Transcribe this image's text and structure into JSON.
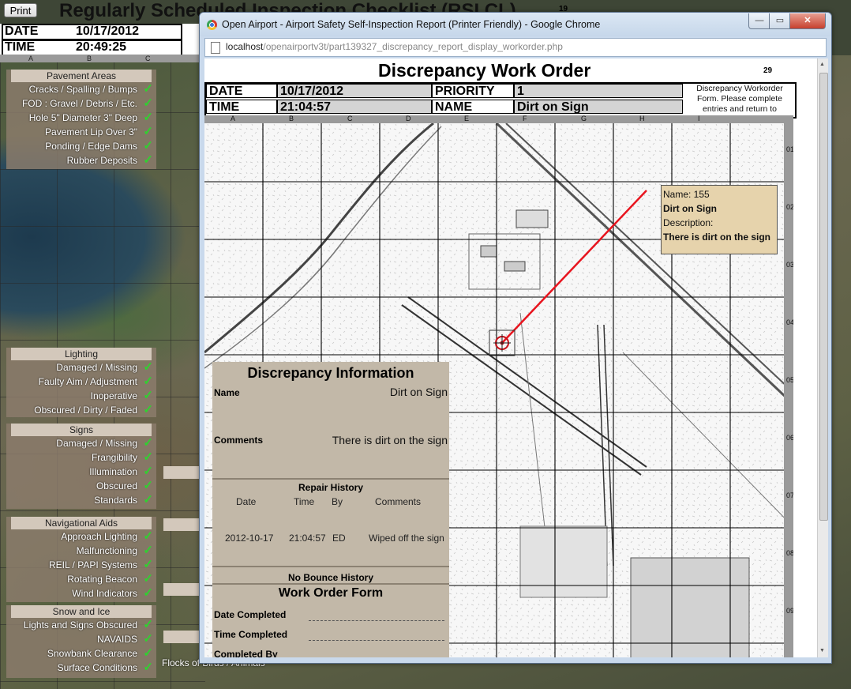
{
  "background": {
    "print_label": "Print",
    "title": "Regularly Scheduled Inspection Checklist (RSI CL)",
    "page_number": "19",
    "date_label": "DATE",
    "date_value": "10/17/2012",
    "time_label": "TIME",
    "time_value": "20:49:25",
    "columns": [
      "A",
      "B",
      "C"
    ],
    "check_glyph": "✓",
    "panels": [
      {
        "title": "Pavement Areas",
        "items": [
          "Cracks / Spalling / Bumps",
          "FOD : Gravel / Debris / Etc.",
          "Hole 5\" Diameter 3\" Deep",
          "Pavement Lip Over 3\"",
          "Ponding / Edge Dams",
          "Rubber Deposits"
        ]
      },
      {
        "title": "Lighting",
        "items": [
          "Damaged / Missing",
          "Faulty Aim / Adjustment",
          "Inoperative",
          "Obscured / Dirty / Faded"
        ]
      },
      {
        "title": "Signs",
        "items": [
          "Damaged / Missing",
          "Frangibility",
          "Illumination",
          "Obscured",
          "Standards"
        ]
      },
      {
        "title": "Navigational Aids",
        "items": [
          "Approach Lighting",
          "Malfunctioning",
          "REIL / PAPI Systems",
          "Rotating Beacon",
          "Wind Indicators"
        ]
      },
      {
        "title": "Snow and Ice",
        "items": [
          "Lights and Signs Obscured",
          "NAVAIDS",
          "Snowbank Clearance",
          "Surface Conditions"
        ]
      }
    ],
    "partial_item": "Flocks of Birds / Animals"
  },
  "browser": {
    "window_title": "Open Airport - Airport Safety Self-Inspection Report (Printer Friendly) - Google Chrome",
    "url_host": "localhost",
    "url_path": "/openairportv3t/part139327_discrepancy_report_display_workorder.php",
    "minimize_glyph": "—",
    "maximize_glyph": "▭",
    "close_glyph": "✕"
  },
  "workorder": {
    "title": "Discrepancy Work Order",
    "page_number": "29",
    "date_label": "DATE",
    "date_value": "10/17/2012",
    "time_label": "TIME",
    "time_value": "21:04:57",
    "priority_label": "PRIORITY",
    "priority_value": "1",
    "name_label": "NAME",
    "name_value": "Dirt on Sign",
    "note": "Discrepancy Workorder Form. Please complete entries and return to management.",
    "map_columns": [
      "A",
      "B",
      "C",
      "D",
      "E",
      "F",
      "G",
      "H",
      "I"
    ],
    "map_rows": [
      "01",
      "02",
      "03",
      "04",
      "05",
      "06",
      "07",
      "08",
      "09"
    ],
    "callout": {
      "name_line": "Name: 155",
      "title": "Dirt on Sign",
      "desc_label": "Description:",
      "desc_value": "There is dirt on the sign"
    },
    "info": {
      "title": "Discrepancy Information",
      "name_label": "Name",
      "name_value": "Dirt on Sign",
      "comments_label": "Comments",
      "comments_value": "There is dirt on the sign",
      "repair_title": "Repair History",
      "repair_headers": [
        "Date",
        "Time",
        "By",
        "Comments"
      ],
      "repair_rows": [
        [
          "2012-10-17",
          "21:04:57",
          "ED",
          "Wiped off the sign"
        ]
      ],
      "bounce_title": "No Bounce History",
      "form_title": "Work Order Form",
      "form_fields": [
        "Date Completed",
        "Time Completed",
        "Completed By"
      ]
    }
  }
}
